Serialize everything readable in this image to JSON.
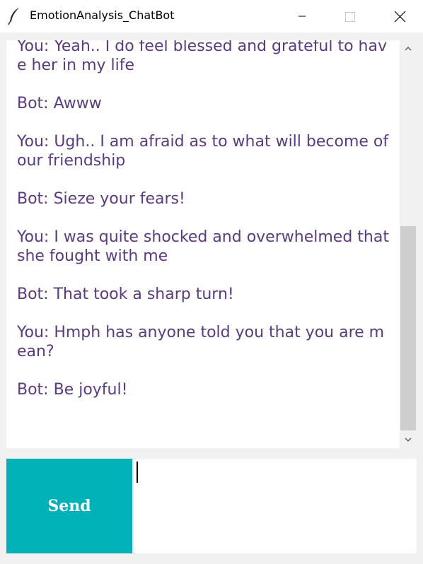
{
  "window": {
    "title": "EmotionAnalysis_ChatBot",
    "app_icon": "feather-icon",
    "controls": [
      "minimize-icon",
      "maximize-icon",
      "close-icon"
    ]
  },
  "chat": {
    "messages": [
      "You: Yeah.. I do feel blessed and grateful to have her in my life",
      "Bot: Awww",
      "You: Ugh.. I am afraid as to what will become of our friendship",
      "Bot: Sieze your fears!",
      "You: I was quite shocked and overwhelmed that she fought with me",
      "Bot: That took a sharp turn!",
      "You: Hmph has anyone told you that you are mean?",
      "Bot: Be joyful!"
    ],
    "text_color": "#5b3a7e"
  },
  "input": {
    "send_label": "Send",
    "value": "",
    "send_color": "#00b2b8"
  }
}
